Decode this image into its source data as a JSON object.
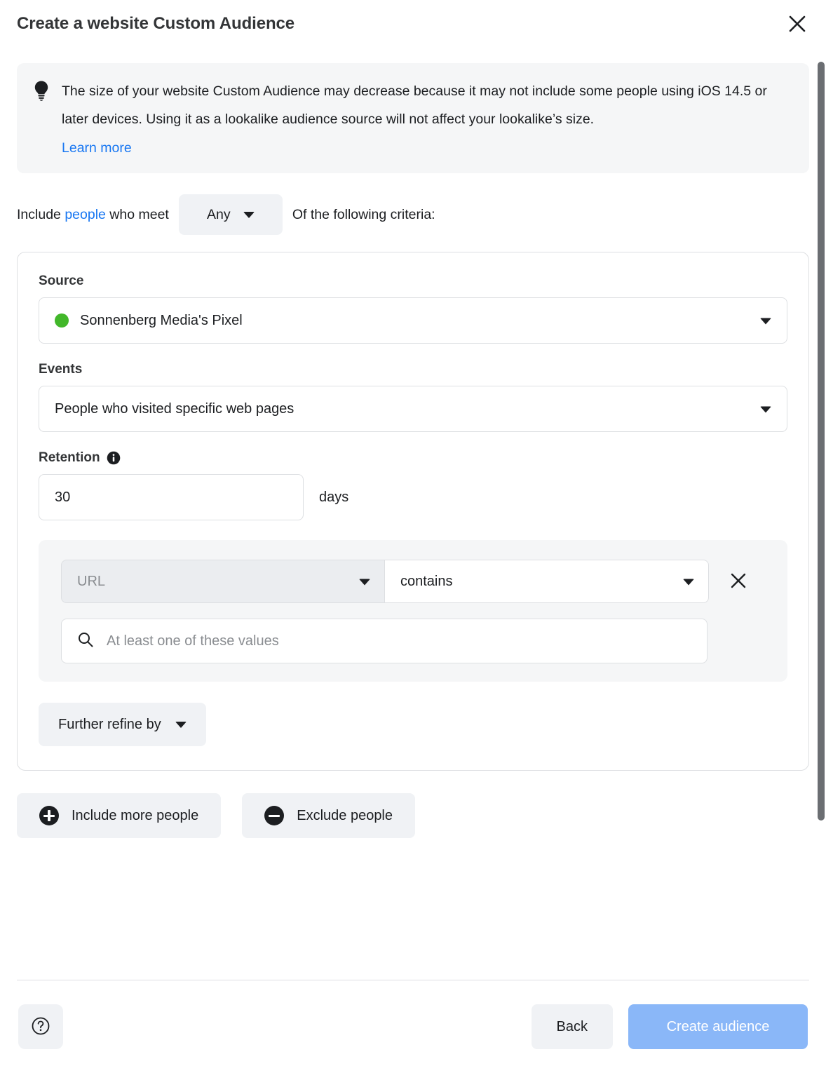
{
  "header": {
    "title": "Create a website Custom Audience",
    "close_icon": "close-icon"
  },
  "banner": {
    "icon": "lightbulb-icon",
    "text": "The size of your website Custom Audience may decrease because it may not include some people using iOS 14.5 or later devices. Using it as a lookalike audience source will not affect your lookalike’s size.",
    "link_label": "Learn more"
  },
  "criteria": {
    "prefix": "Include",
    "people_link": "people",
    "middle": "who meet",
    "match_value": "Any",
    "suffix": "Of the following criteria:"
  },
  "card": {
    "source": {
      "label": "Source",
      "value": "Sonnenberg Media's Pixel",
      "status_color": "#42b72a"
    },
    "events": {
      "label": "Events",
      "value": "People who visited specific web pages"
    },
    "retention": {
      "label": "Retention",
      "info_icon": "info-icon",
      "value": "30",
      "unit": "days"
    },
    "rule": {
      "field_value": "URL",
      "operator_value": "contains",
      "remove_icon": "close-icon",
      "search_icon": "search-icon",
      "search_placeholder": "At least one of these values",
      "search_value": ""
    },
    "refine_label": "Further refine by"
  },
  "actions": {
    "include_label": "Include more people",
    "include_icon": "plus-circle-icon",
    "exclude_label": "Exclude people",
    "exclude_icon": "minus-circle-icon"
  },
  "footer": {
    "help_icon": "question-circle-icon",
    "back_label": "Back",
    "create_label": "Create audience",
    "create_color": "#8ab7f8"
  },
  "colors": {
    "link": "#1877f2",
    "surface": "#f5f6f7",
    "border": "#dddfe2"
  }
}
